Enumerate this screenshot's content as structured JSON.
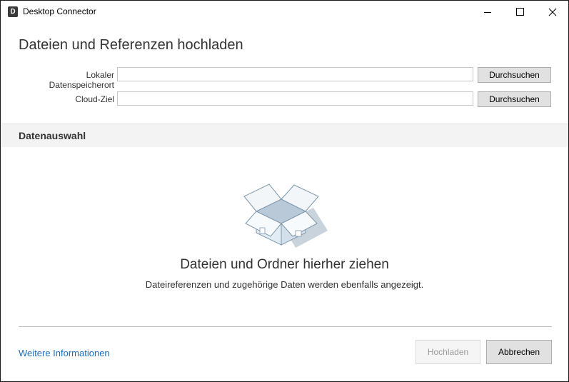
{
  "window": {
    "icon_letter": "D",
    "title": "Desktop Connector"
  },
  "main": {
    "heading": "Dateien und Referenzen hochladen",
    "local_label": "Lokaler Datenspeicherort",
    "local_value": "",
    "cloud_label": "Cloud-Ziel",
    "cloud_value": "",
    "browse_label": "Durchsuchen"
  },
  "section": {
    "title": "Datenauswahl"
  },
  "dropzone": {
    "icon": "open-box-icon",
    "title": "Dateien und Ordner hierher ziehen",
    "subtitle": "Dateireferenzen und zugehörige Daten werden ebenfalls angezeigt."
  },
  "footer": {
    "more_info": "Weitere Informationen",
    "upload_label": "Hochladen",
    "cancel_label": "Abbrechen"
  },
  "colors": {
    "link": "#1a6fc0",
    "section_band": "#f3f3f3",
    "button_bg": "#e1e1e1"
  }
}
